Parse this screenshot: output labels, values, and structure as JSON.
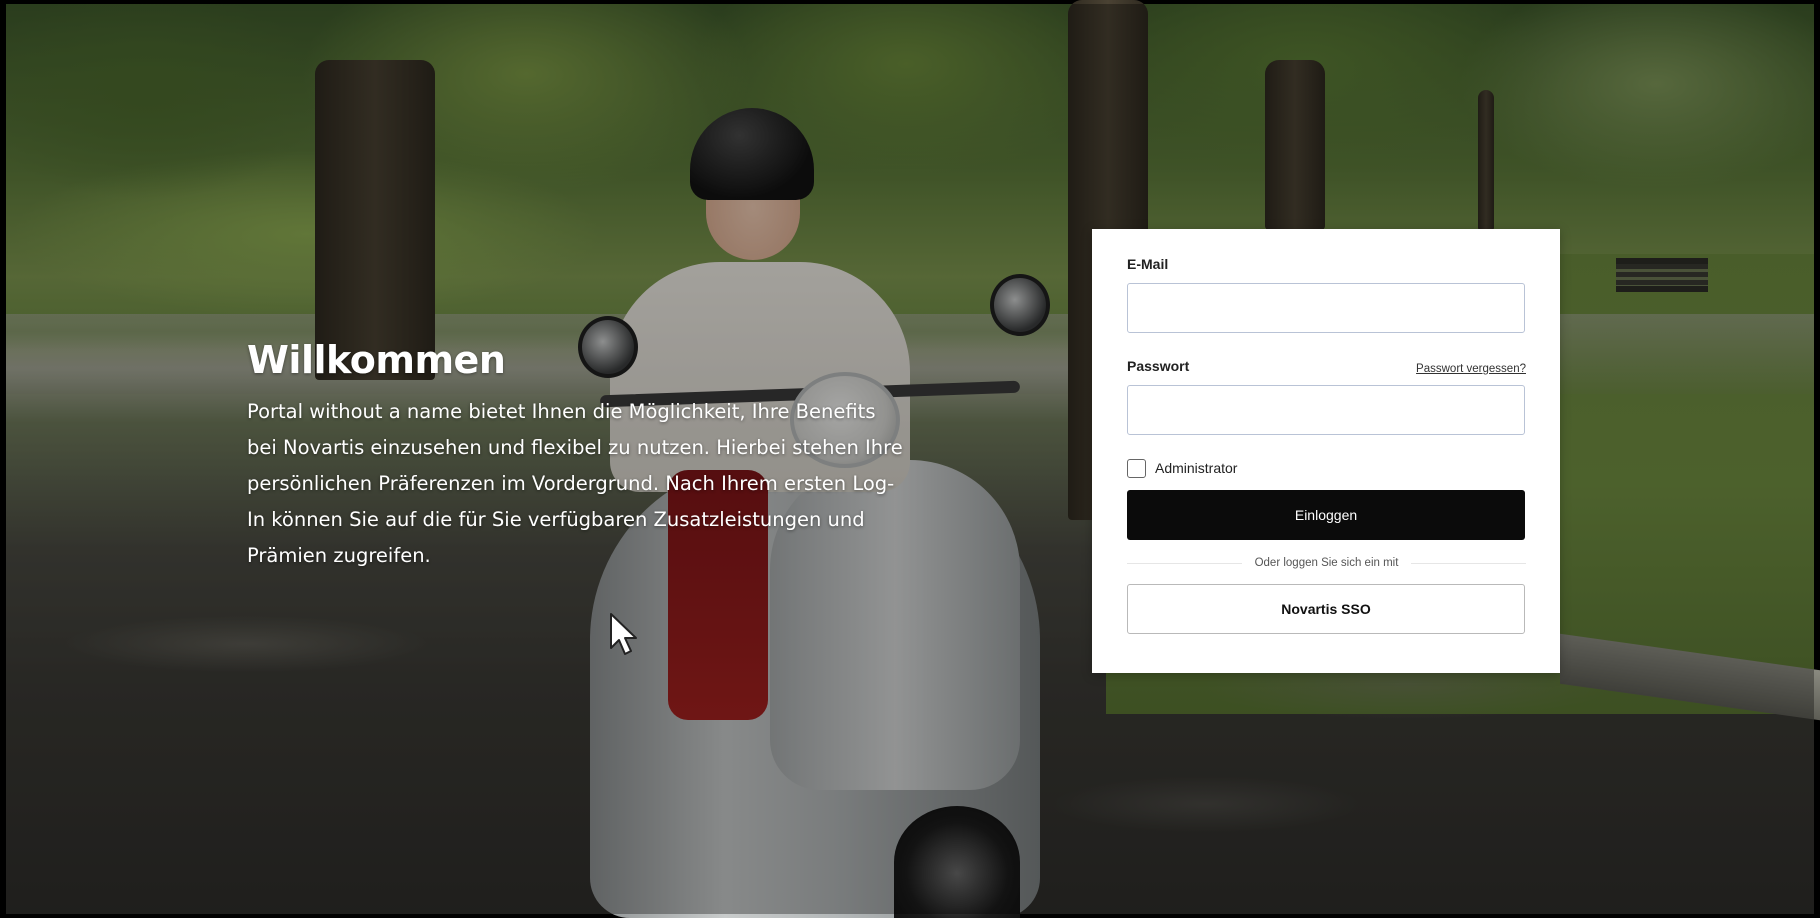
{
  "welcome": {
    "title": "Willkommen",
    "text": "Portal without a name bietet Ihnen die Möglichkeit, Ihre Benefits bei Novartis einzusehen und flexibel zu nutzen. Hierbei stehen Ihre persönlichen Präferenzen im Vordergrund. Nach Ihrem ersten Log-In können Sie auf die für Sie verfügbaren Zusatzleistungen und Prämien zugreifen."
  },
  "login": {
    "email_label": "E-Mail",
    "email_value": "",
    "email_placeholder": "",
    "password_label": "Passwort",
    "password_value": "",
    "password_placeholder": "",
    "forgot_password_label": "Passwort vergessen?",
    "admin_checkbox_label": "Administrator",
    "admin_checked": false,
    "login_button_label": "Einloggen",
    "divider_text": "Oder loggen Sie sich ein mit",
    "sso_button_label": "Novartis SSO"
  },
  "colors": {
    "card_background": "#ffffff",
    "primary_button": "#0b0b0b",
    "input_border": "#b9c3d6",
    "welcome_text": "#ffffff"
  },
  "icons": {
    "cursor": "mouse-pointer-icon"
  }
}
